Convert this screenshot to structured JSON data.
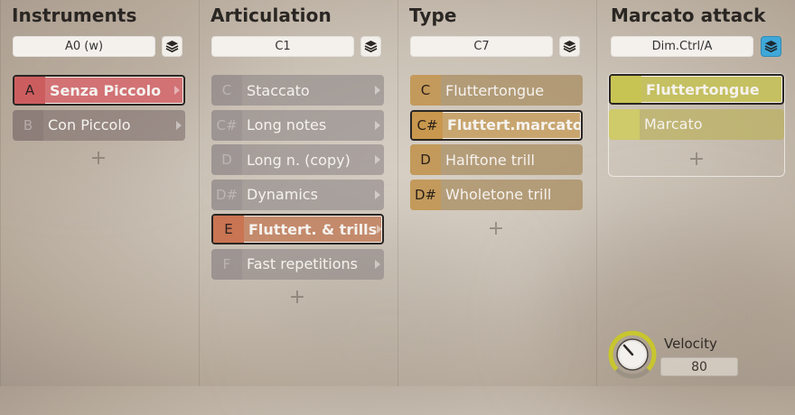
{
  "colors": {
    "instrument_selected": "#d27275",
    "articulation_selected": "#c48a6c",
    "type_item": "#c39a5b",
    "marcato_item": "#c5c061",
    "layer_active": "#3fa8d9",
    "knob_ring": "#c8c62e"
  },
  "instruments": {
    "title": "Instruments",
    "key": "A0 (w)",
    "layer_icon": "layers-icon",
    "items": [
      {
        "key": "A",
        "label": "Senza Piccolo"
      },
      {
        "key": "B",
        "label": "Con Piccolo"
      }
    ],
    "add_label": "+"
  },
  "articulation": {
    "title": "Articulation",
    "key": "C1",
    "layer_icon": "layers-icon",
    "items": [
      {
        "key": "C",
        "label": "Staccato"
      },
      {
        "key": "C#",
        "label": "Long notes"
      },
      {
        "key": "D",
        "label": "Long n. (copy)"
      },
      {
        "key": "D#",
        "label": "Dynamics"
      },
      {
        "key": "E",
        "label": "Fluttert. & trills"
      },
      {
        "key": "F",
        "label": "Fast repetitions"
      }
    ],
    "add_label": "+"
  },
  "type": {
    "title": "Type",
    "key": "C7",
    "layer_icon": "layers-icon",
    "items": [
      {
        "key": "C",
        "label": "Fluttertongue"
      },
      {
        "key": "C#",
        "label": "Fluttert.marcato"
      },
      {
        "key": "D",
        "label": "Halftone trill"
      },
      {
        "key": "D#",
        "label": "Wholetone trill"
      }
    ],
    "add_label": "+"
  },
  "marcato": {
    "title": "Marcato attack",
    "key": "Dim.Ctrl/A",
    "layer_icon": "layers-icon",
    "items": [
      {
        "key": "",
        "label": "Fluttertongue"
      },
      {
        "key": "",
        "label": "Marcato"
      }
    ],
    "add_label": "+"
  },
  "velocity": {
    "label": "Velocity",
    "value": "80"
  }
}
